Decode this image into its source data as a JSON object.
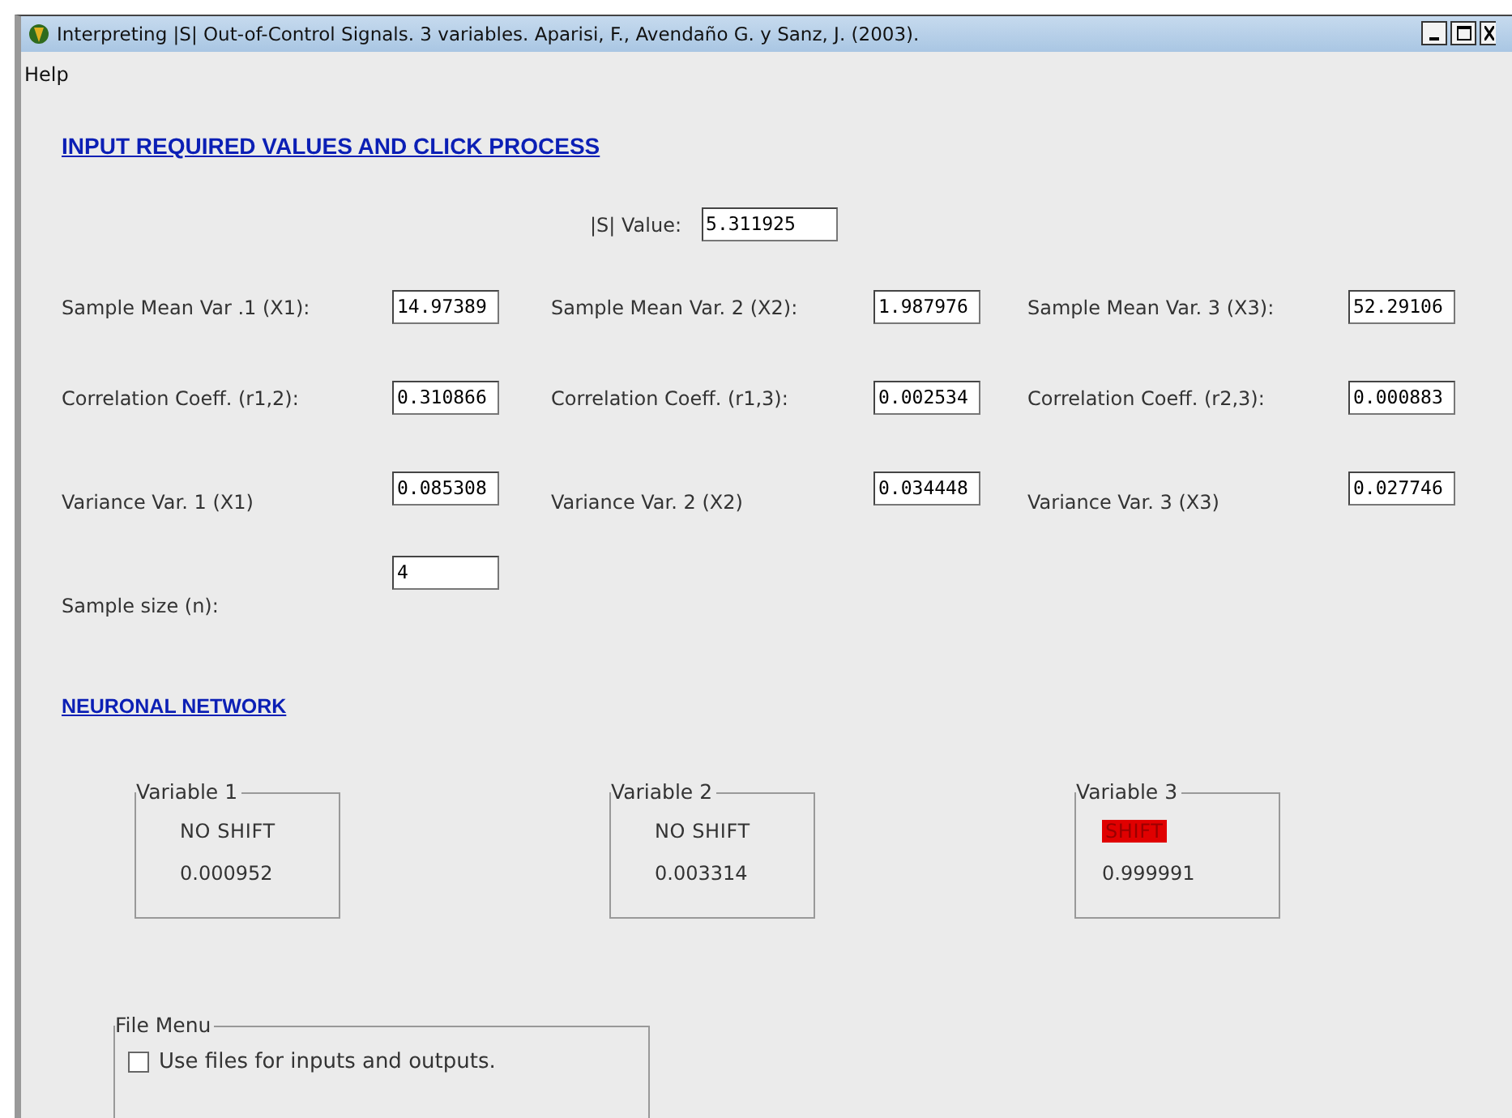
{
  "window": {
    "title": "Interpreting |S| Out-of-Control Signals. 3 variables. Aparisi, F., Avendaño G. y Sanz, J. (2003)."
  },
  "menu": [
    "Help"
  ],
  "input_section": {
    "heading": "INPUT REQUIRED VALUES AND CLICK PROCESS",
    "s_value": {
      "label": "|S| Value:",
      "value": "5.311925"
    },
    "rows": [
      [
        {
          "label": "Sample Mean Var .1 (X1):",
          "value": "14.97389"
        },
        {
          "label": "Sample Mean Var. 2 (X2):",
          "value": "1.987976"
        },
        {
          "label": "Sample Mean Var. 3 (X3):",
          "value": "52.29106"
        }
      ],
      [
        {
          "label": "Correlation Coeff. (r1,2):",
          "value": "0.310866"
        },
        {
          "label": "Correlation Coeff. (r1,3):",
          "value": "0.002534"
        },
        {
          "label": "Correlation Coeff. (r2,3):",
          "value": "0.000883"
        }
      ],
      [
        {
          "label": "Variance Var. 1 (X1)",
          "value": "0.085308"
        },
        {
          "label": "Variance Var. 2 (X2)",
          "value": "0.034448"
        },
        {
          "label": "Variance Var. 3 (X3)",
          "value": "0.027746"
        }
      ],
      [
        {
          "label": "Sample size (n):",
          "value": "4"
        }
      ]
    ]
  },
  "network_section": {
    "heading": "NEURONAL NETWORK",
    "variables": [
      {
        "title": "Variable 1",
        "result": "NO SHIFT",
        "alarm": false,
        "probability": "0.000952"
      },
      {
        "title": "Variable 2",
        "result": "NO SHIFT",
        "alarm": false,
        "probability": "0.003314"
      },
      {
        "title": "Variable 3",
        "result": "SHIFT",
        "alarm": true,
        "probability": "0.999991"
      }
    ]
  },
  "file_menu": {
    "title": "File  Menu",
    "option": {
      "label": "Use files for inputs and outputs.",
      "checked": false
    }
  }
}
